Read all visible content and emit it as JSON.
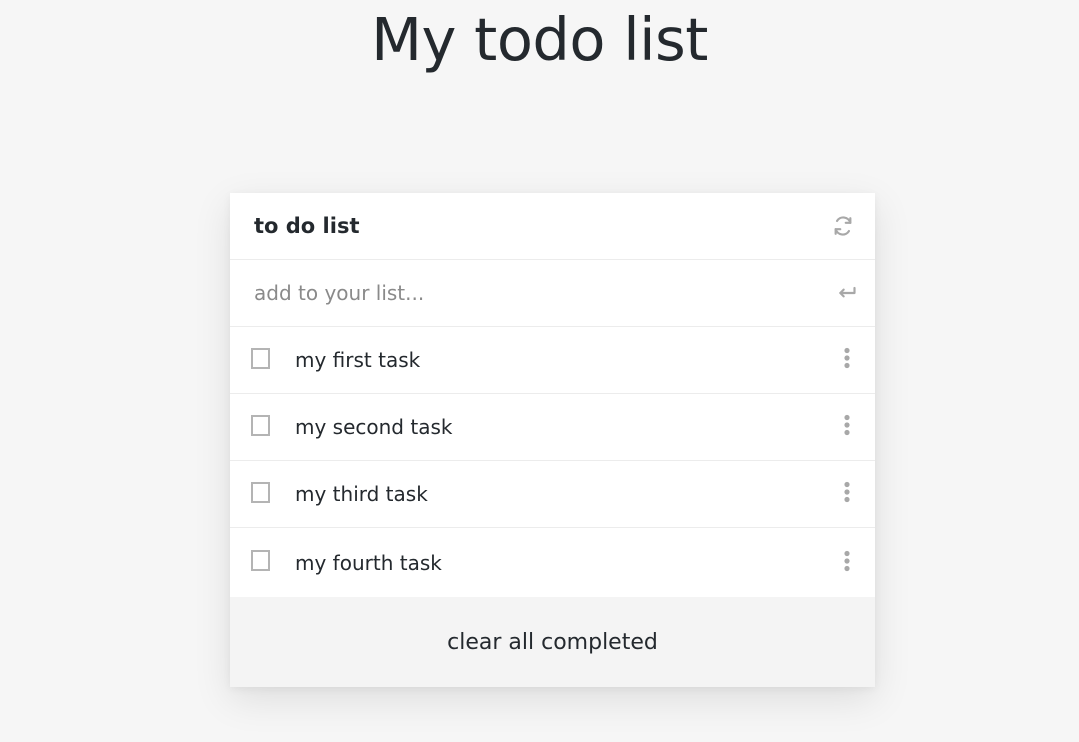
{
  "page": {
    "title": "My todo list"
  },
  "card": {
    "title": "to do list",
    "refresh_icon": "refresh-icon",
    "add_input": {
      "placeholder": "add to your list...",
      "value": ""
    },
    "enter_icon": "enter-icon",
    "tasks": [
      {
        "label": "my first task",
        "checked": false
      },
      {
        "label": "my second task",
        "checked": false
      },
      {
        "label": "my third task",
        "checked": false
      },
      {
        "label": "my fourth task",
        "checked": false
      }
    ],
    "footer": {
      "clear_label": "clear all completed"
    }
  },
  "colors": {
    "background": "#f6f6f6",
    "card": "#ffffff",
    "footer": "#f4f4f4",
    "text": "#24292e",
    "muted_icon": "#a8a8a8",
    "checkbox_border": "#b4b4b4"
  }
}
